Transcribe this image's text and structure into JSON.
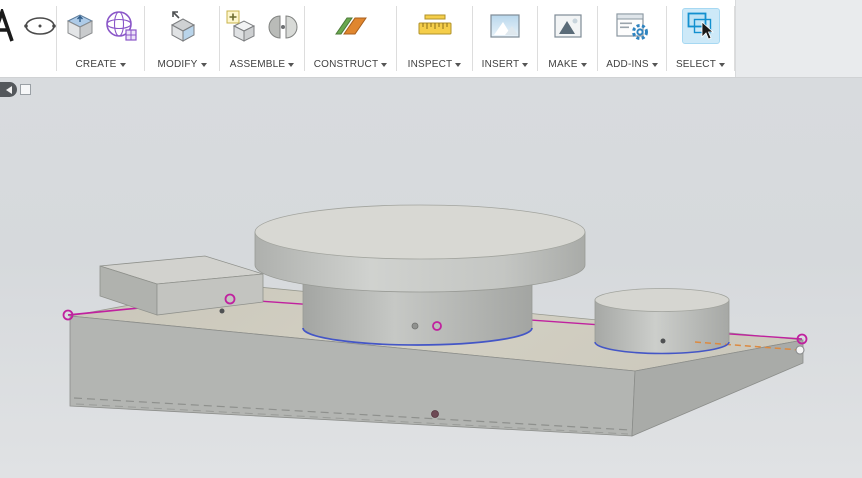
{
  "toolbar": {
    "groups": [
      {
        "label": "",
        "icons": [
          "text-tool-icon",
          "ellipse-tool-icon"
        ]
      },
      {
        "label": "CREATE",
        "icons": [
          "box-primitive-icon",
          "form-sphere-icon"
        ]
      },
      {
        "label": "MODIFY",
        "icons": [
          "press-pull-icon"
        ]
      },
      {
        "label": "ASSEMBLE",
        "icons": [
          "new-component-icon",
          "joint-icon"
        ]
      },
      {
        "label": "CONSTRUCT",
        "icons": [
          "construction-plane-icon"
        ]
      },
      {
        "label": "INSPECT",
        "icons": [
          "measure-icon"
        ]
      },
      {
        "label": "INSERT",
        "icons": [
          "canvas-image-icon"
        ]
      },
      {
        "label": "MAKE",
        "icons": [
          "make-image-icon"
        ]
      },
      {
        "label": "ADD-INS",
        "icons": [
          "scripts-addins-icon"
        ]
      },
      {
        "label": "SELECT",
        "icons": [
          "select-cursor-icon"
        ],
        "highlighted": true
      }
    ]
  },
  "viewport": {
    "background_top": "#d8dbde",
    "background_bottom": "#e0e2e4"
  },
  "colors": {
    "toolbar_bg": "#ffffff",
    "select_highlight": "#cde9f8",
    "accent_blue": "#1898d5",
    "sketch_magenta": "#c0219f",
    "sketch_blue": "#4456c6",
    "construction_orange": "#dc8a40",
    "model_top_face": "#cfccc0",
    "model_front_face": "#b3b5b2",
    "model_side_face": "#a9aba8"
  }
}
